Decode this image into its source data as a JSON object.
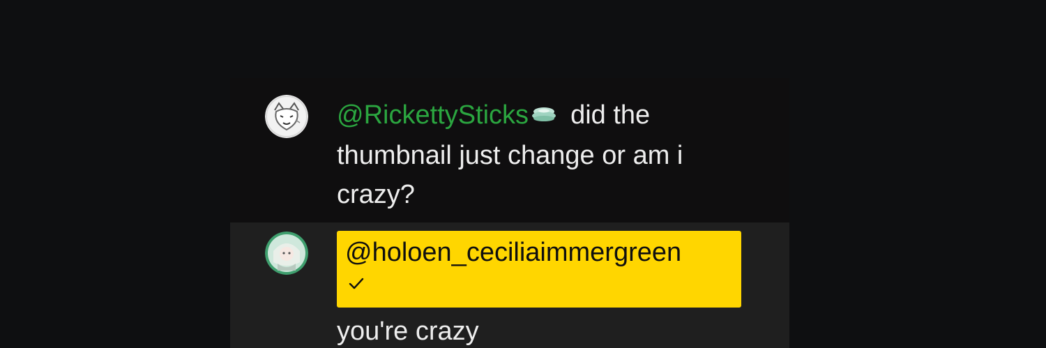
{
  "chat": {
    "messages": [
      {
        "author": "@RickettySticks",
        "author_icon": "moderator-badge-icon",
        "text": "did the thumbnail just change or am i crazy?",
        "author_color": "#2ba640"
      },
      {
        "author": "@holoen_ceciliaimmergreen",
        "author_icon": "check-icon",
        "text": "you're crazy",
        "highlight_color": "#ffd600"
      }
    ]
  },
  "colors": {
    "page_background": "#0e0f11",
    "panel_background": "#0f0e0f",
    "highlighted_row_background": "#1f1f1f",
    "text": "#eeeeee"
  }
}
